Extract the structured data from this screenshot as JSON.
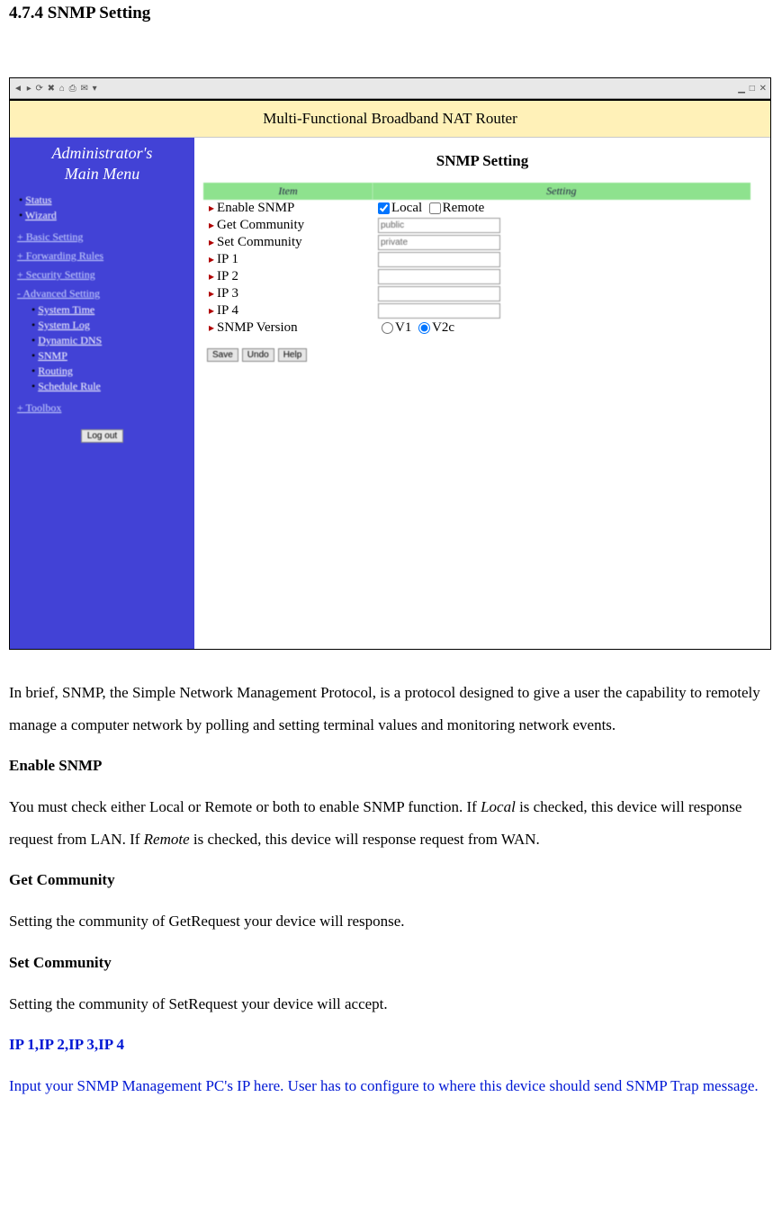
{
  "doc": {
    "section_title": "4.7.4 SNMP Setting",
    "intro": "In brief, SNMP, the Simple Network Management Protocol, is a protocol designed to give a user the capability to remotely manage a computer network by polling and setting terminal values and monitoring network events.",
    "enable_h": "Enable SNMP",
    "enable_p1a": "You must check either Local or Remote or both to enable SNMP function. If ",
    "enable_p1_local": "Local",
    "enable_p1b": " is checked, this device will response request from LAN. If ",
    "enable_p1_remote": "Remote",
    "enable_p1c": " is checked, this device will response request from WAN.",
    "get_h": "Get Community",
    "get_p": "Setting the community of GetRequest your device will response.",
    "set_h": "Set Community",
    "set_p": "Setting the community of SetRequest your device will accept.",
    "ip_h": "IP 1,IP 2,IP 3,IP 4",
    "ip_p": "Input your SNMP Management PC's IP here. User has to configure to where this device should send SNMP Trap message."
  },
  "shot": {
    "banner": "Multi-Functional Broadband NAT Router",
    "sidebar": {
      "admin_line1": "Administrator's",
      "admin_line2": "Main Menu",
      "items_top": [
        "Status",
        "Wizard"
      ],
      "groups": [
        {
          "label": "+ Basic Setting",
          "items": []
        },
        {
          "label": "+ Forwarding Rules",
          "items": []
        },
        {
          "label": "+ Security Setting",
          "items": []
        },
        {
          "label": "- Advanced Setting",
          "items": [
            "System Time",
            "System Log",
            "Dynamic DNS",
            "SNMP",
            "Routing",
            "Schedule Rule"
          ]
        },
        {
          "label": "+ Toolbox",
          "items": []
        }
      ],
      "logout": "Log out"
    },
    "content": {
      "title": "SNMP Setting",
      "th_item": "Item",
      "th_setting": "Setting",
      "rows": {
        "enable": "Enable SNMP",
        "local": "Local",
        "remote": "Remote",
        "get": "Get Community",
        "get_val": "public",
        "set": "Set Community",
        "set_val": "private",
        "ip1": "IP 1",
        "ip2": "IP 2",
        "ip3": "IP 3",
        "ip4": "IP 4",
        "ver": "SNMP Version",
        "v1": "V1",
        "v2c": "V2c"
      },
      "buttons": {
        "save": "Save",
        "undo": "Undo",
        "help": "Help"
      }
    }
  }
}
